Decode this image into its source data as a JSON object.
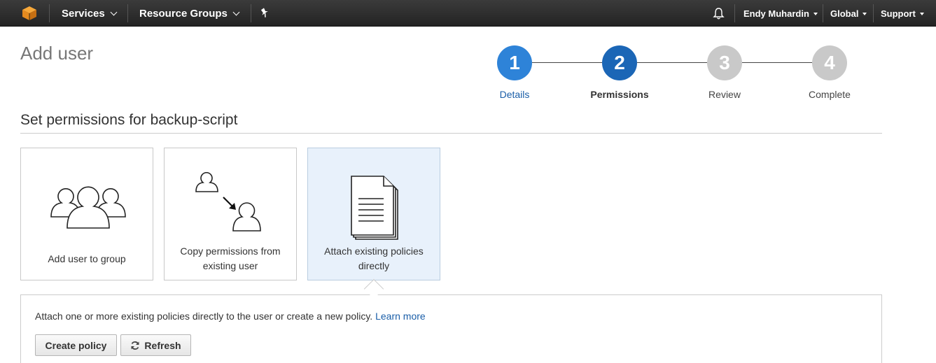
{
  "nav": {
    "logo_icon": "aws-cube-icon",
    "services_label": "Services",
    "resource_groups_label": "Resource Groups",
    "pin_icon": "pin-icon",
    "bell_icon": "bell-icon",
    "user_label": "Endy Muhardin",
    "region_label": "Global",
    "support_label": "Support"
  },
  "page": {
    "title": "Add user"
  },
  "wizard": {
    "steps": [
      {
        "number": "1",
        "label": "Details",
        "state": "done",
        "color": "#2e83d8"
      },
      {
        "number": "2",
        "label": "Permissions",
        "state": "current",
        "color": "#1b66b6"
      },
      {
        "number": "3",
        "label": "Review",
        "state": "pending",
        "color": "#c9c9c9"
      },
      {
        "number": "4",
        "label": "Complete",
        "state": "pending",
        "color": "#c9c9c9"
      }
    ]
  },
  "section": {
    "title": "Set permissions for backup-script"
  },
  "options": [
    {
      "label": "Add user to group",
      "icon": "group-icon",
      "selected": false
    },
    {
      "label_line1": "Copy permissions from",
      "label_line2": "existing user",
      "icon": "copy-user-icon",
      "selected": false
    },
    {
      "label_line1": "Attach existing policies",
      "label_line2": "directly",
      "icon": "document-stack-icon",
      "selected": true
    }
  ],
  "panel": {
    "description": "Attach one or more existing policies directly to the user or create a new policy.",
    "learn_more": "Learn more",
    "create_policy_label": "Create policy",
    "refresh_label": "Refresh",
    "refresh_icon": "refresh-icon"
  }
}
